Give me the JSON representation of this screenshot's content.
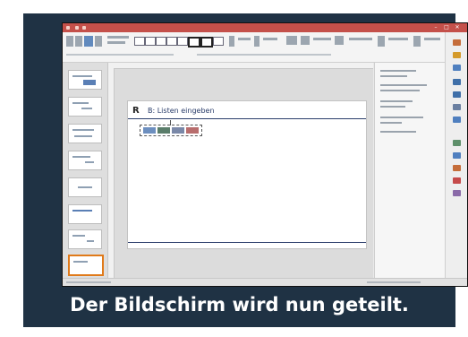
{
  "caption": "Der Bildschirm wird nun geteilt.",
  "slide": {
    "title": "B: Listen eingeben",
    "logo": "R"
  },
  "window": {
    "minimize_glyph": "–",
    "maximize_glyph": "□",
    "close_glyph": "✕"
  },
  "colors": {
    "background": "#1f3244",
    "title_bar": "#c4504a",
    "slide_accent": "#2a3d6a",
    "selected_thumbnail": "#e07a1a",
    "caption_text": "#ffffff"
  },
  "icons": [
    "minimize-icon",
    "maximize-icon",
    "close-icon",
    "ribbon-button-icon",
    "sidebar-tool-icon"
  ]
}
